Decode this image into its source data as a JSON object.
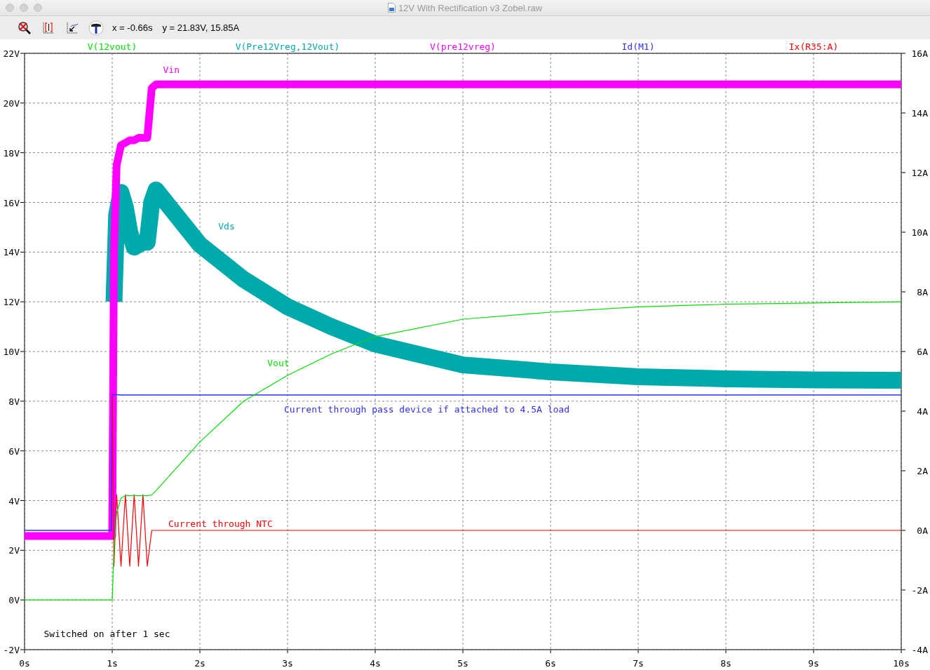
{
  "window": {
    "title": "12V With Rectification v3 Zobel.raw"
  },
  "cursor": {
    "x_readout": "x = -0.66s",
    "y_readout": "y = 21.83V, 15.85A"
  },
  "plot": {
    "chart_data": {
      "type": "line",
      "x": [
        0,
        0.5,
        0.99,
        1.0,
        1.02,
        1.05,
        1.1,
        1.15,
        1.2,
        1.25,
        1.3,
        1.35,
        1.4,
        1.45,
        1.5,
        2,
        2.5,
        3,
        3.5,
        4,
        5,
        6,
        7,
        8,
        9,
        10
      ],
      "grid": true,
      "xlim": [
        0,
        10
      ],
      "ylim": [
        -2,
        22
      ],
      "y2lim": [
        -4,
        16
      ],
      "xticks": [
        {
          "value": 0,
          "label": "0s"
        },
        {
          "value": 1,
          "label": "1s"
        },
        {
          "value": 2,
          "label": "2s"
        },
        {
          "value": 3,
          "label": "3s"
        },
        {
          "value": 4,
          "label": "4s"
        },
        {
          "value": 5,
          "label": "5s"
        },
        {
          "value": 6,
          "label": "6s"
        },
        {
          "value": 7,
          "label": "7s"
        },
        {
          "value": 8,
          "label": "8s"
        },
        {
          "value": 9,
          "label": "9s"
        },
        {
          "value": 10,
          "label": "10s"
        }
      ],
      "yticks": [
        {
          "value": -2,
          "label": "-2V"
        },
        {
          "value": 0,
          "label": "0V"
        },
        {
          "value": 2,
          "label": "2V"
        },
        {
          "value": 4,
          "label": "4V"
        },
        {
          "value": 6,
          "label": "6V"
        },
        {
          "value": 8,
          "label": "8V"
        },
        {
          "value": 10,
          "label": "10V"
        },
        {
          "value": 12,
          "label": "12V"
        },
        {
          "value": 14,
          "label": "14V"
        },
        {
          "value": 16,
          "label": "16V"
        },
        {
          "value": 18,
          "label": "18V"
        },
        {
          "value": 20,
          "label": "20V"
        },
        {
          "value": 22,
          "label": "22V"
        }
      ],
      "y2ticks": [
        {
          "value": -4,
          "label": "-4A"
        },
        {
          "value": -2,
          "label": "-2A"
        },
        {
          "value": 0,
          "label": "0A"
        },
        {
          "value": 2,
          "label": "2A"
        },
        {
          "value": 4,
          "label": "4A"
        },
        {
          "value": 6,
          "label": "6A"
        },
        {
          "value": 8,
          "label": "8A"
        },
        {
          "value": 10,
          "label": "10A"
        },
        {
          "value": 12,
          "label": "12A"
        },
        {
          "value": 14,
          "label": "14A"
        },
        {
          "value": 16,
          "label": "16A"
        }
      ],
      "series": [
        {
          "name": "V(12vout)",
          "color": "#00e000",
          "values": [
            0,
            0,
            0,
            0,
            2,
            3.5,
            4.1,
            4.2,
            4.2,
            4.2,
            4.2,
            4.2,
            4.2,
            4.22,
            4.4,
            6.36,
            8,
            9.04,
            9.9,
            10.6,
            11.3,
            11.58,
            11.8,
            11.9,
            11.95,
            12.0
          ]
        },
        {
          "name": "V(Pre12Vreg,12Vout)",
          "color": "#00aaaa",
          "values": [
            null,
            null,
            null,
            null,
            12,
            15.5,
            16.4,
            15.8,
            14.8,
            14.2,
            14.3,
            14.4,
            14.4,
            16,
            16.5,
            14.3,
            12.9,
            11.8,
            11.0,
            10.3,
            9.46,
            9.18,
            8.98,
            8.9,
            8.86,
            8.84
          ]
        },
        {
          "name": "V(pre12vreg)",
          "color": "#ff00ff",
          "values": [
            2.57,
            2.57,
            2.57,
            2.57,
            14,
            17.5,
            18.3,
            18.4,
            18.5,
            18.5,
            18.6,
            18.6,
            18.6,
            20.6,
            20.75,
            20.75,
            20.75,
            20.75,
            20.75,
            20.75,
            20.75,
            20.75,
            20.75,
            20.75,
            20.75,
            20.75
          ]
        },
        {
          "name": "Id(M1)",
          "color": "#3030ff",
          "axis": "y2",
          "values": [
            0,
            0,
            0,
            4.55,
            4.55,
            4.55,
            4.54,
            4.54,
            4.54,
            4.54,
            4.54,
            4.54,
            4.54,
            4.54,
            4.54,
            4.54,
            4.54,
            4.54,
            4.54,
            4.54,
            4.54,
            4.54,
            4.54,
            4.54,
            4.54,
            4.54
          ]
        },
        {
          "name": "Ix(R35:A)",
          "color": "#ff0000",
          "axis": "y2",
          "values": [
            null,
            null,
            null,
            4.5,
            -1.2,
            1.2,
            -1.2,
            1.2,
            -1.2,
            1.2,
            -1.2,
            1.2,
            -1.2,
            0,
            0,
            0,
            0,
            0,
            0,
            0,
            0,
            0,
            0,
            0,
            0,
            0
          ]
        }
      ],
      "annotations": [
        "Vin",
        "Vds",
        "Vout",
        "Current through pass device if attached to 4.5A load",
        "Current through NTC",
        "Switched on after 1 sec"
      ]
    }
  }
}
